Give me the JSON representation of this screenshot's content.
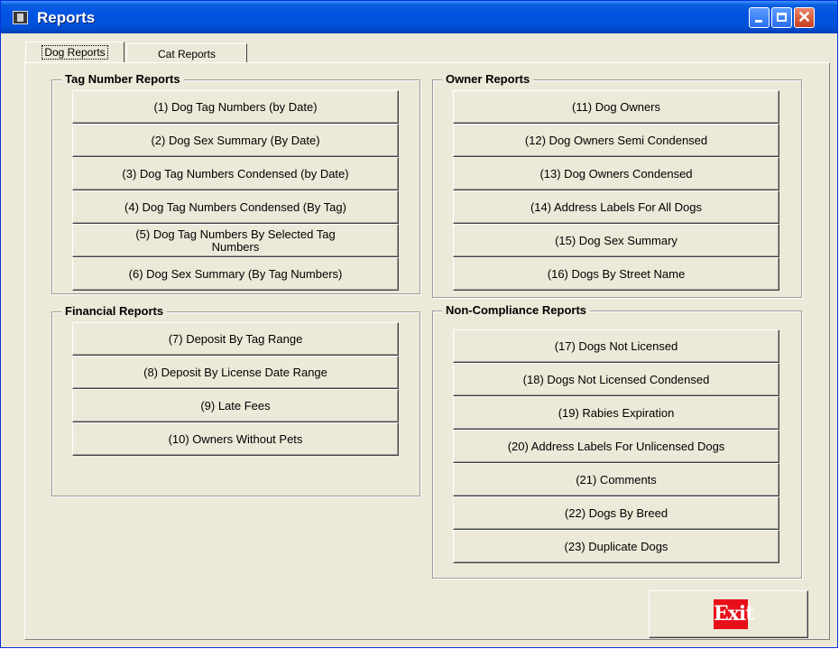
{
  "window": {
    "title": "Reports"
  },
  "tabs": [
    {
      "label": "Dog Reports"
    },
    {
      "label": "Cat Reports"
    }
  ],
  "groups": {
    "tag_number": {
      "title": "Tag Number Reports",
      "buttons": [
        "(1) Dog Tag Numbers (by Date)",
        "(2) Dog Sex Summary (By Date)",
        "(3) Dog Tag Numbers Condensed (by Date)",
        "(4) Dog Tag Numbers Condensed (By Tag)",
        "(5) Dog Tag Numbers By Selected Tag Numbers",
        "(6) Dog Sex Summary (By Tag Numbers)"
      ]
    },
    "owner": {
      "title": "Owner Reports",
      "buttons": [
        "(11) Dog Owners",
        "(12) Dog Owners Semi Condensed",
        "(13) Dog Owners Condensed",
        "(14) Address Labels For All Dogs",
        "(15) Dog Sex Summary",
        "(16) Dogs By Street Name"
      ]
    },
    "financial": {
      "title": "Financial Reports",
      "buttons": [
        "(7) Deposit By Tag Range",
        "(8) Deposit By License Date Range",
        "(9) Late Fees",
        "(10) Owners Without Pets"
      ]
    },
    "non_compliance": {
      "title": "Non-Compliance Reports",
      "buttons": [
        "(17) Dogs Not Licensed",
        "(18) Dogs Not Licensed Condensed",
        "(19) Rabies Expiration",
        "(20) Address Labels For Unlicensed Dogs",
        "(21) Comments",
        "(22) Dogs By Breed",
        "(23) Duplicate Dogs"
      ]
    }
  },
  "exit": {
    "label": "Exit"
  }
}
